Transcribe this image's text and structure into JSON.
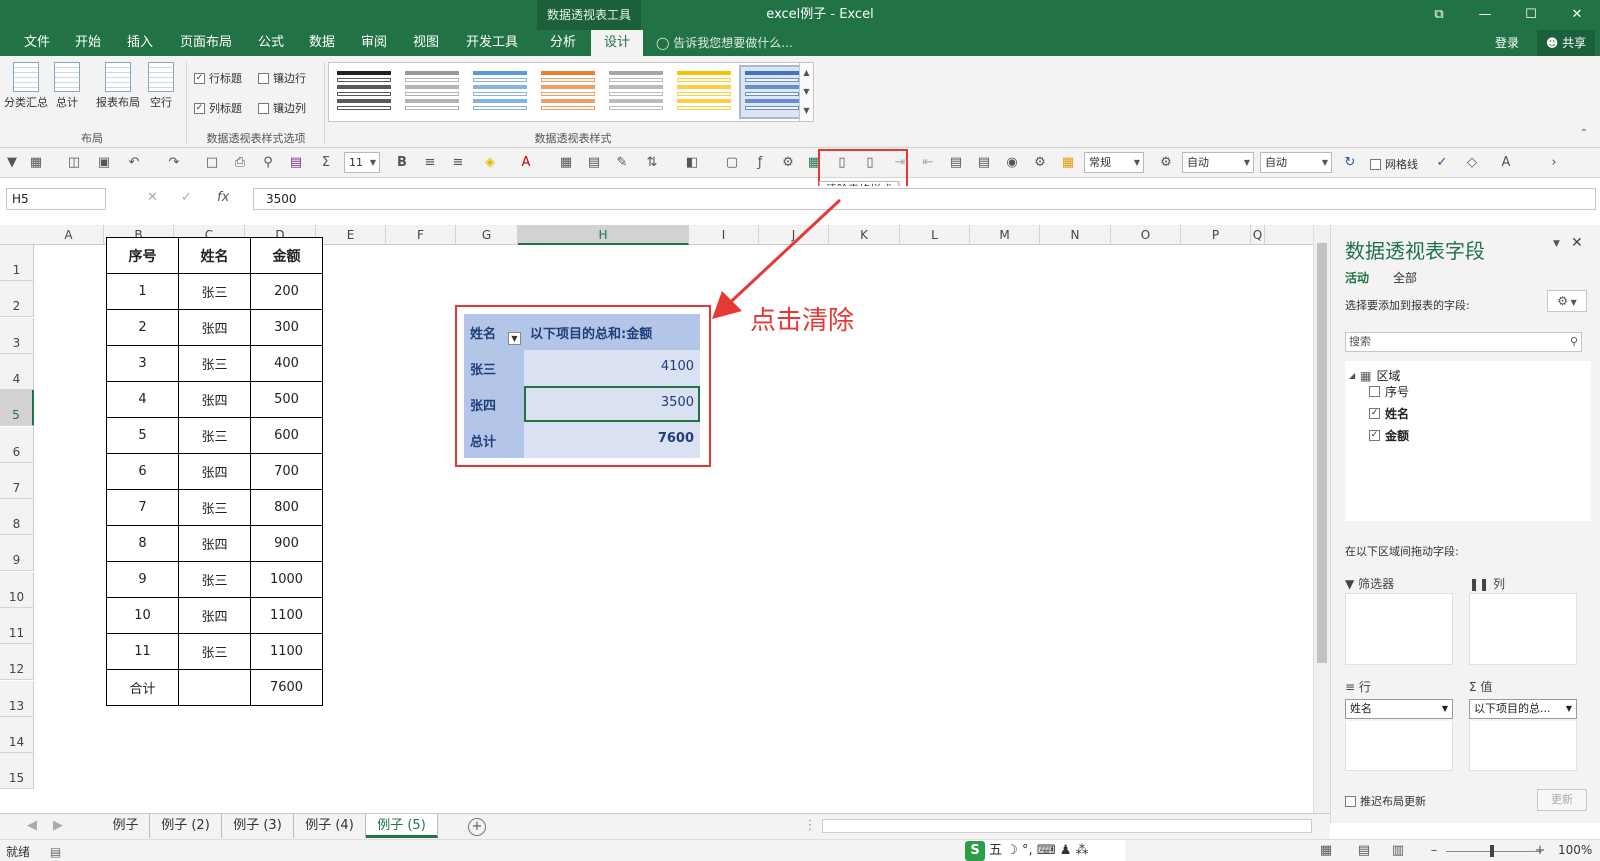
{
  "window": {
    "title": "excel例子 - Excel",
    "context_tool": "数据透视表工具",
    "controls": [
      "⧉",
      "—",
      "☐",
      "✕"
    ]
  },
  "tabs": [
    "文件",
    "开始",
    "插入",
    "页面布局",
    "公式",
    "数据",
    "审阅",
    "视图",
    "开发工具",
    "分析",
    "设计"
  ],
  "active_tab": "设计",
  "tellme": "告诉我您想要做什么...",
  "account": {
    "login": "登录",
    "share": "共享"
  },
  "ribbon": {
    "layout_buttons": [
      "分类汇总",
      "总计",
      "报表布局",
      "空行"
    ],
    "layout_group": "布局",
    "style_options": [
      {
        "label": "行标题",
        "checked": true
      },
      {
        "label": "镶边行",
        "checked": false
      },
      {
        "label": "列标题",
        "checked": true
      },
      {
        "label": "镶边列",
        "checked": false
      }
    ],
    "style_options_group": "数据透视表样式选项",
    "styles_group": "数据透视表样式",
    "style_colors": [
      "#222222",
      "#9a9a9a",
      "#5b9bd5",
      "#ed7d31",
      "#a5a5a5",
      "#ffc000",
      "#4472c4"
    ]
  },
  "qat": {
    "font_size": "11",
    "number_format": "常规",
    "auto1": "自动",
    "auto2": "自动",
    "gridlines": "网格线",
    "tooltip": "清除表格样式"
  },
  "formula_bar": {
    "name_box": "H5",
    "fx": "fx",
    "value": "3500"
  },
  "grid": {
    "columns": [
      "A",
      "B",
      "C",
      "D",
      "E",
      "F",
      "G",
      "H",
      "I",
      "J",
      "K",
      "L",
      "M",
      "N",
      "O",
      "P",
      "Q"
    ],
    "rows": [
      "1",
      "2",
      "3",
      "4",
      "5",
      "6",
      "7",
      "8",
      "9",
      "10",
      "11",
      "12",
      "13",
      "14",
      "15"
    ],
    "selected_column": "H",
    "selected_row": "5"
  },
  "source_table": {
    "headers": [
      "序号",
      "姓名",
      "金额"
    ],
    "rows": [
      [
        "1",
        "张三",
        "200"
      ],
      [
        "2",
        "张四",
        "300"
      ],
      [
        "3",
        "张三",
        "400"
      ],
      [
        "4",
        "张四",
        "500"
      ],
      [
        "5",
        "张三",
        "600"
      ],
      [
        "6",
        "张四",
        "700"
      ],
      [
        "7",
        "张三",
        "800"
      ],
      [
        "8",
        "张四",
        "900"
      ],
      [
        "9",
        "张三",
        "1000"
      ],
      [
        "10",
        "张四",
        "1100"
      ],
      [
        "11",
        "张三",
        "1100"
      ],
      [
        "合计",
        "",
        "7600"
      ]
    ]
  },
  "pivot": {
    "row_header": "姓名",
    "value_header": "以下项目的总和:金额",
    "rows": [
      {
        "name": "张三",
        "value": "4100"
      },
      {
        "name": "张四",
        "value": "3500"
      }
    ],
    "total_label": "总计",
    "total_value": "7600"
  },
  "annotation": "点击清除",
  "field_pane": {
    "title": "数据透视表字段",
    "tabs": [
      "活动",
      "全部"
    ],
    "prompt": "选择要添加到报表的字段:",
    "search_placeholder": "搜索",
    "table_name": "区域",
    "fields": [
      {
        "label": "序号",
        "checked": false
      },
      {
        "label": "姓名",
        "checked": true
      },
      {
        "label": "金额",
        "checked": true
      }
    ],
    "drag_prompt": "在以下区域间拖动字段:",
    "areas": {
      "filter": "筛选器",
      "columns": "列",
      "rows": "行",
      "values": "值"
    },
    "row_field": "姓名",
    "value_field": "以下项目的总...",
    "defer_label": "推迟布局更新",
    "update_label": "更新"
  },
  "sheets": [
    "例子",
    "例子 (2)",
    "例子 (3)",
    "例子 (4)",
    "例子 (5)"
  ],
  "active_sheet": "例子 (5)",
  "status": {
    "ready": "就绪",
    "zoom": "100%",
    "ime": "五 ☽ °, ⌨ ♟ ⁂"
  },
  "colors": {
    "excel_green": "#217346",
    "highlight_red": "#e53935",
    "pivot_fill": "#d9e1f2",
    "pivot_header": "#b4c6e7",
    "pivot_text": "#1f3e7a"
  }
}
